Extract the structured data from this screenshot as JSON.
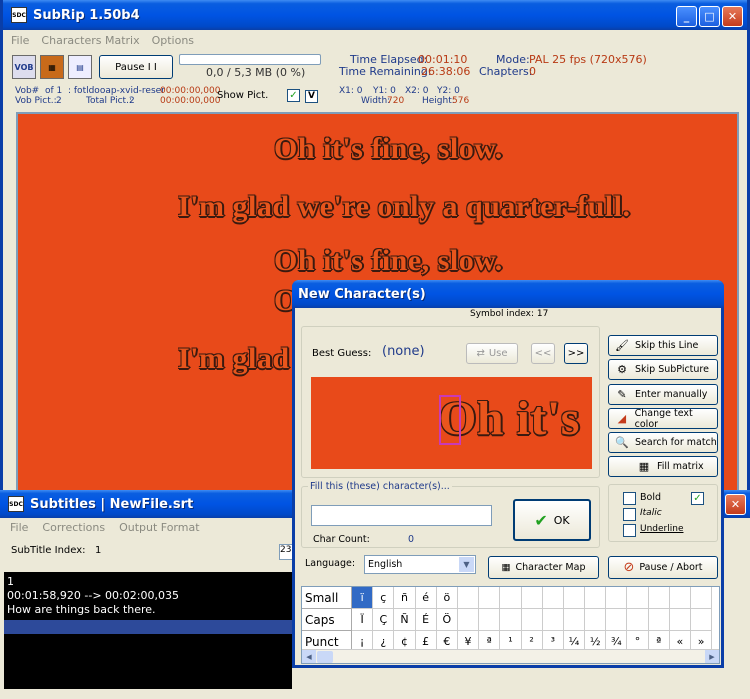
{
  "main": {
    "title": "SubRip 1.50b4",
    "menu": [
      "File",
      "Characters Matrix",
      "Options"
    ],
    "toolbar": {
      "vob_icon": "VOB",
      "pause_label": "Pause  I I",
      "progress_text": "0,0 / 5,3 MB (0 %)",
      "progress_value": 0,
      "time_elapsed_label": "Time Elapsed:",
      "time_elapsed": "00:01:10",
      "time_remaining_label": "Time Remaining:",
      "time_remaining": "26:38:06",
      "mode_label": "Mode:",
      "mode": "PAL 25 fps (720x576)",
      "chapters_label": "Chapters:",
      "chapters": "0"
    },
    "info": {
      "vob_label": "Vob#",
      "vob_value": "of  1",
      "file": ": fotldooap-xvid-reser",
      "time1": "00:00:00,000",
      "vob_pict_label": "Vob Pict.:",
      "vob_pict": "2",
      "total_pict_label": "Total Pict.:",
      "total_pict": "2",
      "time2": "00:00:00,000",
      "show_pict": "Show Pict.",
      "v_label": "V",
      "x1": "X1: 0",
      "y1": "Y1: 0",
      "x2": "X2: 0",
      "y2": "Y2: 0",
      "width_label": "Width:",
      "width": "720",
      "height_label": "Height:",
      "height": "576"
    },
    "preview_lines": [
      "Oh it's fine, slow.",
      "I'm glad we're only a quarter-full.",
      "Oh it's fine, slow.",
      "O",
      "I'm glad w"
    ]
  },
  "subtitles": {
    "title": "Subtitles  |  NewFile.srt",
    "menu": [
      "File",
      "Corrections",
      "Output Format"
    ],
    "index_label": "SubTitle Index:",
    "index_value": "1",
    "partial_value": "23",
    "text_lines": [
      "1",
      "00:01:58,920 --> 00:02:00,035",
      "How are things back there."
    ]
  },
  "dialog": {
    "title": "New Character(s)",
    "symbol_index": "Symbol index: 17",
    "best_guess_label": "Best Guess:",
    "best_guess_value": "(none)",
    "use_label": "Use",
    "prev_label": "<<",
    "next_label": ">>",
    "preview_text": "Oh it's",
    "fill_label": "Fill this (these) character(s)...",
    "char_input_value": "",
    "char_count_label": "Char Count:",
    "char_count": "0",
    "ok_label": "OK",
    "language_label": "Language:",
    "language_value": "English",
    "buttons": {
      "skip_line": "Skip this Line",
      "skip_subpicture": "Skip SubPicture",
      "enter_manually": "Enter manually",
      "change_color": "Change text color",
      "search_match": "Search for match",
      "fill_matrix": "Fill matrix",
      "character_map": "Character Map",
      "pause_abort": "Pause / Abort"
    },
    "bold_label": "Bold",
    "italic_label": "Italic",
    "underline_label": "Underline",
    "grid": {
      "small_label": "Small",
      "caps_label": "Caps",
      "punct_label": "Punct",
      "small": [
        "ï",
        "ç",
        "ñ",
        "é",
        "ö",
        "",
        "",
        "",
        "",
        "",
        "",
        "",
        "",
        "",
        "",
        "",
        ""
      ],
      "caps": [
        "Ï",
        "Ç",
        "Ñ",
        "É",
        "Ö",
        "",
        "",
        "",
        "",
        "",
        "",
        "",
        "",
        "",
        "",
        "",
        ""
      ],
      "punct": [
        "¡",
        "¿",
        "¢",
        "£",
        "€",
        "¥",
        "ª",
        "¹",
        "²",
        "³",
        "¼",
        "½",
        "¾",
        "°",
        "ª",
        "«",
        "»"
      ]
    }
  }
}
